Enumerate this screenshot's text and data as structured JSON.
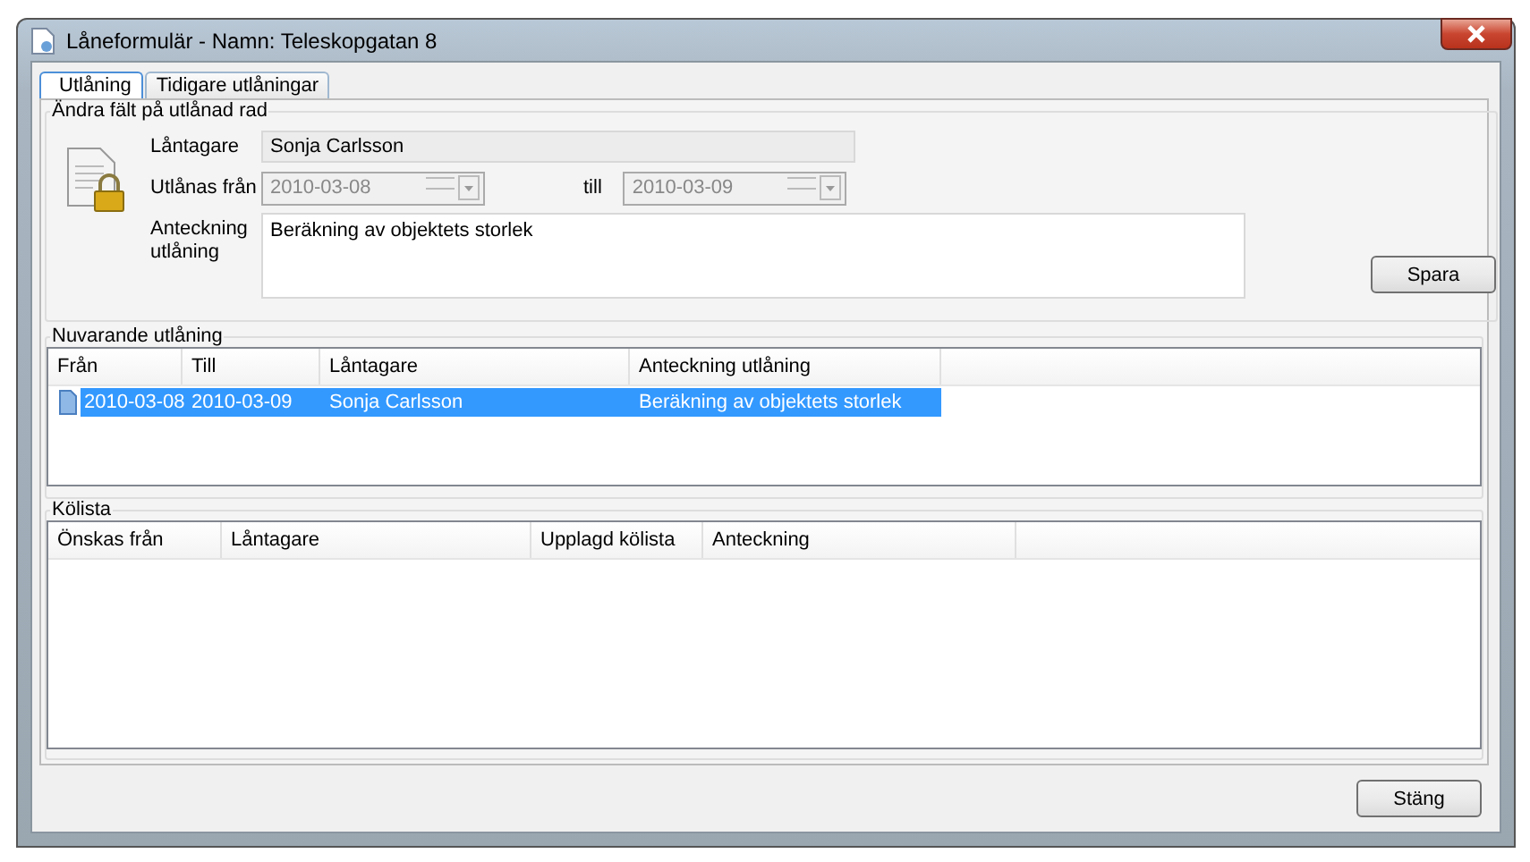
{
  "window": {
    "title": "Låneformulär - Namn: Teleskopgatan 8"
  },
  "tabs": [
    {
      "label": "Utlåning",
      "selected": true
    },
    {
      "label": "Tidigare utlåningar",
      "selected": false
    }
  ],
  "edit_group": {
    "title": "Ändra fält på utlånad rad",
    "borrower_label": "Låntagare",
    "borrower_value": "Sonja Carlsson",
    "from_label": "Utlånas från",
    "from_value": "2010-03-08",
    "to_label": "till",
    "to_value": "2010-03-09",
    "note_label": "Anteckning utlåning",
    "note_value": "Beräkning av objektets storlek",
    "save_button": "Spara"
  },
  "current_loans": {
    "title": "Nuvarande utlåning",
    "columns": [
      "Från",
      "Till",
      "Låntagare",
      "Anteckning utlåning"
    ],
    "rows": [
      {
        "cells": [
          "2010-03-08",
          "2010-03-09",
          "Sonja Carlsson",
          "Beräkning av objektets storlek"
        ],
        "selected": true
      }
    ]
  },
  "queue": {
    "title": "Kölista",
    "columns": [
      "Önskas från",
      "Låntagare",
      "Upplagd kölista",
      "Anteckning"
    ]
  },
  "close_button": "Stäng"
}
